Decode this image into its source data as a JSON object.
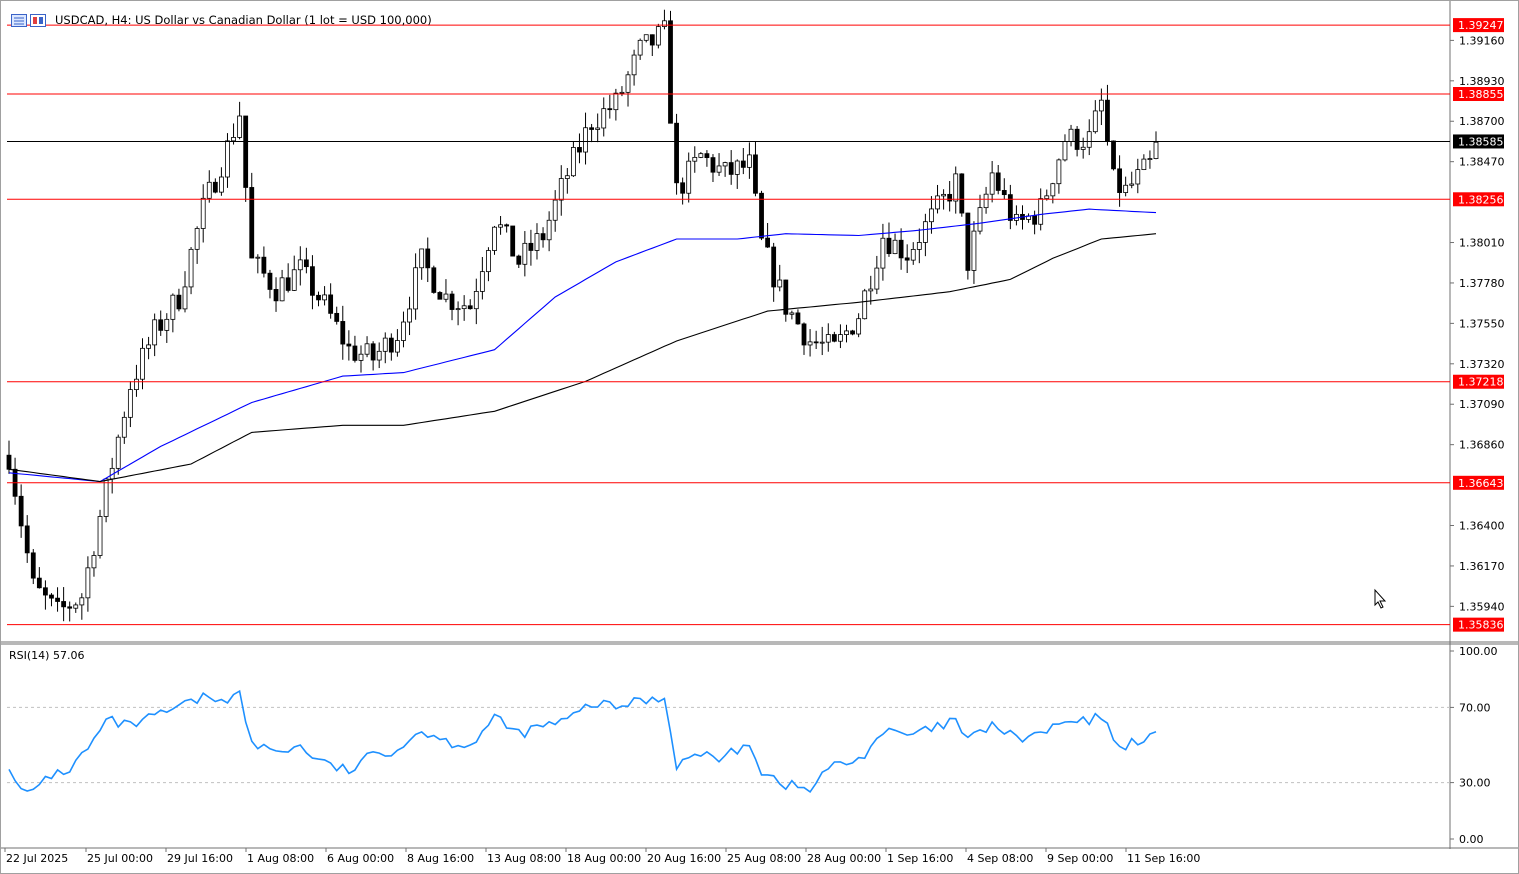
{
  "header": {
    "symbol_title": "USDCAD, H4:  US Dollar vs Canadian Dollar (1 lot = USD 100,000)"
  },
  "indicator": {
    "label": "RSI(14) 57.06"
  },
  "colors": {
    "up_candle": "#ffffff",
    "down_candle": "#000000",
    "level_line": "#ff0000",
    "current_line": "#000000",
    "ma_fast": "#0000ff",
    "ma_slow": "#000000",
    "rsi_line": "#1e90ff",
    "grid_dash": "#c0c0c0"
  },
  "chart_data": [
    {
      "type": "candlestick",
      "price_axis_ticks": [
        "1.39160",
        "1.38930",
        "1.38700",
        "1.38470",
        "1.38010",
        "1.37780",
        "1.37550",
        "1.37320",
        "1.37090",
        "1.36860",
        "1.36400",
        "1.36170",
        "1.35940"
      ],
      "ylim": [
        1.3576,
        1.3935
      ],
      "time_axis_labels": [
        "22 Jul 2025",
        "25 Jul 00:00",
        "29 Jul 16:00",
        "1 Aug 08:00",
        "6 Aug 00:00",
        "8 Aug 16:00",
        "13 Aug 08:00",
        "18 Aug 00:00",
        "20 Aug 16:00",
        "25 Aug 08:00",
        "28 Aug 00:00",
        "1 Sep 16:00",
        "4 Sep 08:00",
        "9 Sep 00:00",
        "11 Sep 16:00"
      ],
      "horizontal_levels": [
        {
          "label": "1.39247",
          "value": 1.39247,
          "kind": "resistance"
        },
        {
          "label": "1.38855",
          "value": 1.38855,
          "kind": "resistance"
        },
        {
          "label": "1.38585",
          "value": 1.38585,
          "kind": "current"
        },
        {
          "label": "1.38256",
          "value": 1.38256,
          "kind": "resistance"
        },
        {
          "label": "1.37218",
          "value": 1.37218,
          "kind": "support"
        },
        {
          "label": "1.36643",
          "value": 1.36643,
          "kind": "support"
        },
        {
          "label": "1.35836",
          "value": 1.35836,
          "kind": "support"
        }
      ],
      "close_path": [
        [
          0,
          1.368
        ],
        [
          4,
          1.3605
        ],
        [
          8,
          1.359
        ],
        [
          12,
          1.36
        ],
        [
          16,
          1.366
        ],
        [
          20,
          1.372
        ],
        [
          24,
          1.375
        ],
        [
          28,
          1.377
        ],
        [
          32,
          1.382
        ],
        [
          36,
          1.3855
        ],
        [
          38,
          1.3875
        ],
        [
          40,
          1.379
        ],
        [
          44,
          1.3775
        ],
        [
          48,
          1.3785
        ],
        [
          52,
          1.3765
        ],
        [
          56,
          1.374
        ],
        [
          60,
          1.3735
        ],
        [
          64,
          1.375
        ],
        [
          68,
          1.379
        ],
        [
          72,
          1.377
        ],
        [
          76,
          1.3765
        ],
        [
          80,
          1.3815
        ],
        [
          84,
          1.379
        ],
        [
          88,
          1.3805
        ],
        [
          92,
          1.384
        ],
        [
          96,
          1.387
        ],
        [
          100,
          1.388
        ],
        [
          104,
          1.391
        ],
        [
          108,
          1.392
        ],
        [
          110,
          1.383
        ],
        [
          114,
          1.385
        ],
        [
          118,
          1.384
        ],
        [
          122,
          1.3845
        ],
        [
          124,
          1.38
        ],
        [
          128,
          1.3765
        ],
        [
          132,
          1.3745
        ],
        [
          136,
          1.374
        ],
        [
          140,
          1.376
        ],
        [
          144,
          1.3805
        ],
        [
          148,
          1.3795
        ],
        [
          152,
          1.3815
        ],
        [
          156,
          1.3835
        ],
        [
          158,
          1.379
        ],
        [
          162,
          1.384
        ],
        [
          166,
          1.381
        ],
        [
          170,
          1.382
        ],
        [
          174,
          1.386
        ],
        [
          178,
          1.386
        ],
        [
          180,
          1.388
        ],
        [
          182,
          1.3835
        ],
        [
          184,
          1.383
        ],
        [
          188,
          1.3845
        ],
        [
          189,
          1.3855
        ]
      ],
      "ma_fast_path": [
        [
          0,
          1.367
        ],
        [
          15,
          1.3665
        ],
        [
          25,
          1.3685
        ],
        [
          40,
          1.371
        ],
        [
          55,
          1.3725
        ],
        [
          65,
          1.3727
        ],
        [
          80,
          1.374
        ],
        [
          90,
          1.377
        ],
        [
          100,
          1.379
        ],
        [
          110,
          1.3803
        ],
        [
          120,
          1.3803
        ],
        [
          128,
          1.3806
        ],
        [
          140,
          1.3805
        ],
        [
          150,
          1.3808
        ],
        [
          160,
          1.3812
        ],
        [
          170,
          1.3817
        ],
        [
          178,
          1.382
        ],
        [
          189,
          1.3818
        ]
      ],
      "ma_slow_path": [
        [
          0,
          1.3672
        ],
        [
          15,
          1.3665
        ],
        [
          30,
          1.3675
        ],
        [
          40,
          1.3693
        ],
        [
          55,
          1.3697
        ],
        [
          65,
          1.3697
        ],
        [
          80,
          1.3705
        ],
        [
          95,
          1.3722
        ],
        [
          110,
          1.3745
        ],
        [
          125,
          1.3762
        ],
        [
          140,
          1.3767
        ],
        [
          155,
          1.3773
        ],
        [
          165,
          1.378
        ],
        [
          172,
          1.3792
        ],
        [
          180,
          1.3803
        ],
        [
          189,
          1.3806
        ]
      ],
      "bars_count": 190,
      "ma_names": [
        "MA fast (blue)",
        "MA slow (black)"
      ]
    },
    {
      "type": "line",
      "name": "RSI(14)",
      "value": 57.06,
      "y_ticks": [
        "100.00",
        "70.00",
        "30.00",
        "0.00"
      ],
      "ylim": [
        0,
        100
      ],
      "levels": [
        70,
        30
      ],
      "series_path": [
        [
          0,
          40
        ],
        [
          2,
          25
        ],
        [
          4,
          24
        ],
        [
          6,
          33
        ],
        [
          10,
          37
        ],
        [
          14,
          52
        ],
        [
          16,
          63
        ],
        [
          20,
          60
        ],
        [
          24,
          65
        ],
        [
          28,
          70
        ],
        [
          32,
          75
        ],
        [
          36,
          75
        ],
        [
          38,
          77
        ],
        [
          40,
          50
        ],
        [
          44,
          47
        ],
        [
          48,
          49
        ],
        [
          52,
          40
        ],
        [
          56,
          36
        ],
        [
          60,
          45
        ],
        [
          64,
          48
        ],
        [
          68,
          58
        ],
        [
          72,
          52
        ],
        [
          76,
          50
        ],
        [
          80,
          64
        ],
        [
          84,
          56
        ],
        [
          88,
          60
        ],
        [
          92,
          63
        ],
        [
          96,
          72
        ],
        [
          100,
          70
        ],
        [
          104,
          74
        ],
        [
          108,
          75
        ],
        [
          110,
          40
        ],
        [
          114,
          45
        ],
        [
          118,
          43
        ],
        [
          122,
          52
        ],
        [
          124,
          36
        ],
        [
          128,
          29
        ],
        [
          132,
          26
        ],
        [
          135,
          38
        ],
        [
          140,
          42
        ],
        [
          144,
          57
        ],
        [
          148,
          55
        ],
        [
          152,
          58
        ],
        [
          156,
          63
        ],
        [
          158,
          52
        ],
        [
          162,
          61
        ],
        [
          166,
          53
        ],
        [
          170,
          56
        ],
        [
          174,
          62
        ],
        [
          178,
          62
        ],
        [
          180,
          66
        ],
        [
          182,
          52
        ],
        [
          184,
          50
        ],
        [
          188,
          55
        ],
        [
          189,
          57.06
        ]
      ]
    }
  ]
}
